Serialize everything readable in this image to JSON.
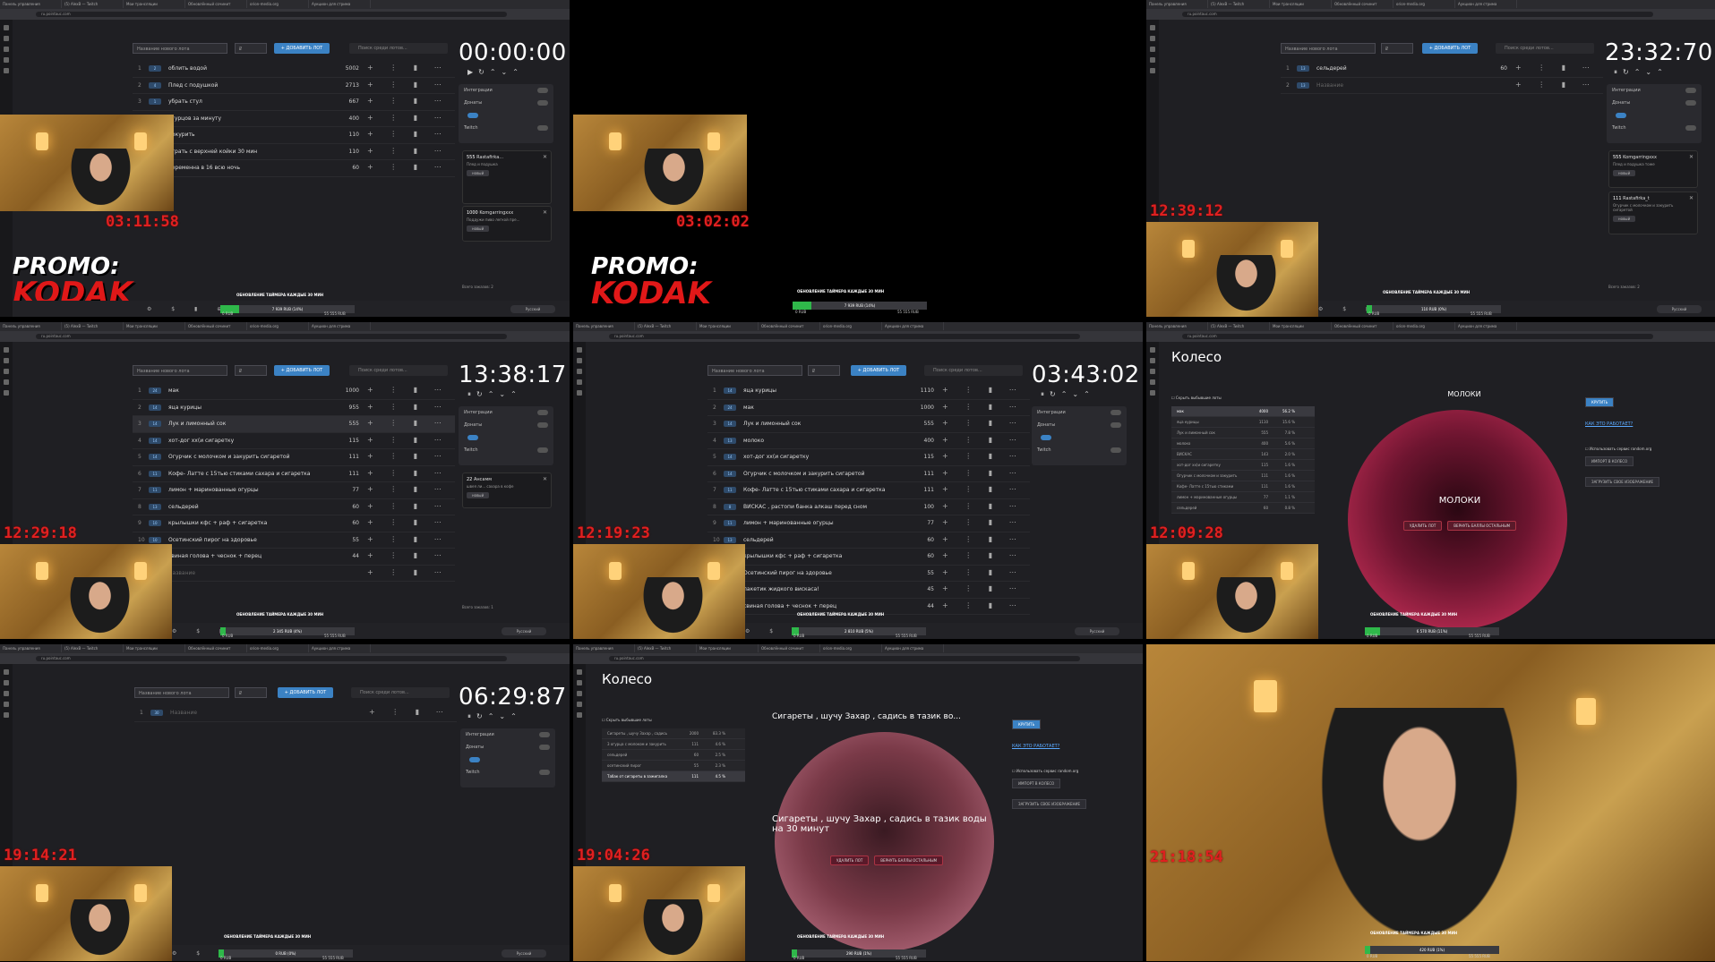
{
  "common": {
    "new_lot_placeholder": "Название нового лота",
    "amount_placeholder": "₽",
    "add_button": "+ ДОБАВИТЬ ЛОТ",
    "search_placeholder": "Поиск среди лотов...",
    "integrations": "Интеграции",
    "donations": "Донаты",
    "twitch": "Twitch",
    "progress_title": "ОБНОВЛЕНИЕ ТАЙМЕРА КАЖДЫЕ 30 МИН",
    "progress_min": "0 RUB",
    "progress_max": "55 555 RUB",
    "language": "Русский",
    "promo_line1": "PROMO:",
    "promo_line2": "KODAK",
    "url": "ru.pointauc.com",
    "tabs": [
      "Панель управления",
      "(5) AlexB — Twitch",
      "Мои трансляции",
      "Обновлённый сочинит",
      "orion-media.org",
      "Аукцион для стрима"
    ],
    "accept": "новый"
  },
  "tiles": [
    {
      "id": "t1",
      "timer": "00:00:00",
      "clock": "03:11:58",
      "progress_label": "7 939 RUB (14%)",
      "progress_pct": 14,
      "total": "Всего заказов: 2",
      "lots": [
        {
          "n": "1",
          "badge": "2",
          "name": "облить водой",
          "amount": "5002"
        },
        {
          "n": "2",
          "badge": "4",
          "name": "Плед с подушкой",
          "amount": "2713"
        },
        {
          "n": "3",
          "badge": "1",
          "name": "убрать стул",
          "amount": "667"
        },
        {
          "n": "4",
          "badge": "",
          "name": "огурцов за минуту",
          "amount": "400"
        },
        {
          "n": "5",
          "badge": "",
          "name": "покурить",
          "amount": "110"
        },
        {
          "n": "6",
          "badge": "",
          "name": "играть с верхней койки 30 мин",
          "amount": "110"
        },
        {
          "n": "7",
          "badge": "",
          "name": "беременна в 16 всю ночь",
          "amount": "60"
        }
      ],
      "donations": [
        {
          "amount": "555",
          "user": "Rastafirka...",
          "text": "Плед и подушка"
        },
        {
          "amount": "1000",
          "user": "Komgarringxxx",
          "text": "Поддужи пиво легкой пре..."
        }
      ]
    },
    {
      "id": "t2",
      "clock": "03:02:02",
      "progress_label": "7 939 RUB (14%)",
      "progress_pct": 14
    },
    {
      "id": "t3",
      "timer": "23:32:70",
      "clock": "12:39:12",
      "progress_label": "110 RUB (0%)",
      "progress_pct": 0,
      "total": "Всего заказов: 2",
      "lots": [
        {
          "n": "1",
          "badge": "13",
          "name": "сельдерей",
          "amount": "60"
        },
        {
          "n": "2",
          "badge": "13",
          "name": "Название",
          "amount": ""
        }
      ],
      "donations": [
        {
          "amount": "555",
          "user": "Komgarringxxx",
          "text": "Плед и подушка тоже"
        },
        {
          "amount": "111",
          "user": "Rastafirka_t",
          "text": "Огурчик с молочком и закурить сигаретой"
        }
      ]
    },
    {
      "id": "t4",
      "timer": "13:38:17",
      "clock": "12:29:18",
      "progress_label": "2 345 RUB (4%)",
      "progress_pct": 4,
      "total": "Всего заказов: 1",
      "lots": [
        {
          "n": "1",
          "badge": "24",
          "name": "мак",
          "amount": "1000"
        },
        {
          "n": "2",
          "badge": "14",
          "name": "яца курицы",
          "amount": "955"
        },
        {
          "n": "3",
          "badge": "14",
          "name": "Лук и лимонный сок",
          "amount": "555"
        },
        {
          "n": "4",
          "badge": "14",
          "name": "хот-дог хх(и сигаретку",
          "amount": "115"
        },
        {
          "n": "5",
          "badge": "14",
          "name": "Огурчик с молочком и закурить сигаретой",
          "amount": "111"
        },
        {
          "n": "6",
          "badge": "11",
          "name": "Кофе- Латте с 15тью стиками сахара и сигаретка",
          "amount": "111"
        },
        {
          "n": "7",
          "badge": "11",
          "name": "лимон + маринованные огурцы",
          "amount": "77"
        },
        {
          "n": "8",
          "badge": "13",
          "name": "сельдерей",
          "amount": "60"
        },
        {
          "n": "9",
          "badge": "10",
          "name": "крылышки кфс + раф + сигаретка",
          "amount": "60"
        },
        {
          "n": "10",
          "badge": "10",
          "name": "Осетинский пирог на здоровье",
          "amount": "55"
        },
        {
          "n": "",
          "badge": "",
          "name": "свиная голова + чеснок + перец",
          "amount": "44"
        },
        {
          "n": "",
          "badge": "",
          "name": "Название",
          "amount": ""
        }
      ],
      "donations": [
        {
          "amount": "22",
          "user": "Ансамм",
          "text": "швея ли... сахара в кофе"
        }
      ]
    },
    {
      "id": "t5",
      "timer": "03:43:02",
      "clock": "12:19:23",
      "progress_label": "2 810 RUB (5%)",
      "progress_pct": 5,
      "lots": [
        {
          "n": "1",
          "badge": "14",
          "name": "яца курицы",
          "amount": "1110"
        },
        {
          "n": "2",
          "badge": "24",
          "name": "мак",
          "amount": "1000"
        },
        {
          "n": "3",
          "badge": "14",
          "name": "Лук и лимонный сок",
          "amount": "555"
        },
        {
          "n": "4",
          "badge": "13",
          "name": "молоко",
          "amount": "400"
        },
        {
          "n": "5",
          "badge": "14",
          "name": "хот-дог хх(и сигаретку",
          "amount": "115"
        },
        {
          "n": "6",
          "badge": "14",
          "name": "Огурчик с молочком и закурить сигаретой",
          "amount": "111"
        },
        {
          "n": "7",
          "badge": "11",
          "name": "Кофе- Латте с 15тью стиками сахара и сигаретка",
          "amount": "111"
        },
        {
          "n": "8",
          "badge": "8",
          "name": "ВИСКАС , растопи банка алкаш перед сном",
          "amount": "100"
        },
        {
          "n": "9",
          "badge": "11",
          "name": "лимон + маринованные огурцы",
          "amount": "77"
        },
        {
          "n": "10",
          "badge": "13",
          "name": "сельдерей",
          "amount": "60"
        },
        {
          "n": "",
          "badge": "",
          "name": "крылышки кфс + раф + сигаретка",
          "amount": "60"
        },
        {
          "n": "",
          "badge": "",
          "name": "Осетинский пирог на здоровье",
          "amount": "55"
        },
        {
          "n": "",
          "badge": "",
          "name": "пакетик жидкого вискаса!",
          "amount": "45"
        },
        {
          "n": "",
          "badge": "",
          "name": "свиная голова + чеснок + перец",
          "amount": "44"
        }
      ]
    },
    {
      "id": "t6",
      "title": "Колесо",
      "clock": "12:09:28",
      "hide_label": "Скрыть выбывшие лоты",
      "wheel_top": "МОЛОКИ",
      "wheel_center": "МОЛОКИ",
      "btn_delete": "УДАЛИТЬ ЛОТ",
      "btn_return": "ВЕРНУТЬ БАЛЛЫ ОСТАЛЬНЫМ",
      "spin": "КРУТИТЬ",
      "link": "КАК ЭТО РАБОТАЕТ?",
      "random_org": "Использовать сервис random.org",
      "import": "ИМПОРТ В КОЛЕСО",
      "upload": "ЗАГРУЗИТЬ СВОЕ ИЗОБРАЖЕНИЕ",
      "progress_label": "6 570 RUB (11%)",
      "progress_pct": 11,
      "list": [
        {
          "name": "мак",
          "amount": "4000",
          "pct": "56.2 %",
          "sel": true
        },
        {
          "name": "яца курицы",
          "amount": "1110",
          "pct": "15.6 %"
        },
        {
          "name": "Лук и лимонный сок",
          "amount": "555",
          "pct": "7.8 %"
        },
        {
          "name": "молоко",
          "amount": "400",
          "pct": "5.6 %"
        },
        {
          "name": "ВИСКАС",
          "amount": "143",
          "pct": "2.0 %"
        },
        {
          "name": "хот-дог хх(и сигаретку",
          "amount": "115",
          "pct": "1.6 %"
        },
        {
          "name": "Огурчик с молочком и закурить",
          "amount": "111",
          "pct": "1.6 %"
        },
        {
          "name": "Кофе- Латте с 15тью стиками",
          "amount": "111",
          "pct": "1.6 %"
        },
        {
          "name": "лимон + маринованные огурцы",
          "amount": "77",
          "pct": "1.1 %"
        },
        {
          "name": "сельдерей",
          "amount": "60",
          "pct": "0.8 %"
        }
      ]
    },
    {
      "id": "t7",
      "timer": "06:29:87",
      "clock": "19:14:21",
      "progress_label": "0 RUB (0%)",
      "progress_pct": 0,
      "lots": [
        {
          "n": "1",
          "badge": "30",
          "name": "Название",
          "amount": ""
        }
      ]
    },
    {
      "id": "t8",
      "title": "Колесо",
      "clock": "19:04:26",
      "hide_label": "Скрыть выбывшие лоты",
      "wheel_top": "Сигареты , шучу Захар , садись в тазик во...",
      "wheel_center": "Сигареты , шучу Захар , садись в тазик воды на 30 минут",
      "btn_delete": "УДАЛИТЬ ЛОТ",
      "btn_return": "ВЕРНУТЬ БАЛЛЫ ОСТАЛЬНЫМ",
      "spin": "КРУТИТЬ",
      "link": "КАК ЭТО РАБОТАЕТ?",
      "random_org": "Использовать сервис random.org",
      "import": "ИМПОРТ В КОЛЕСО",
      "upload": "ЗАГРУЗИТЬ СВОЕ ИЗОБРАЖЕНИЕ",
      "progress_label": "290 RUB (1%)",
      "progress_pct": 1,
      "list": [
        {
          "name": "Сигареты , шучу Захар , садись",
          "amount": "2000",
          "pct": "83.3 %"
        },
        {
          "name": "3 огурца с молоком и закурить",
          "amount": "111",
          "pct": "4.6 %"
        },
        {
          "name": "сельдерей",
          "amount": "60",
          "pct": "2.5 %"
        },
        {
          "name": "осетинский пирог",
          "amount": "55",
          "pct": "2.3 %"
        },
        {
          "name": "Табак от сигареты в зажигалка",
          "amount": "111",
          "pct": "4.5 %",
          "sel": true
        }
      ]
    },
    {
      "id": "t9",
      "clock": "21:18:54",
      "progress_label": "420 RUB (1%)",
      "progress_pct": 1
    }
  ]
}
